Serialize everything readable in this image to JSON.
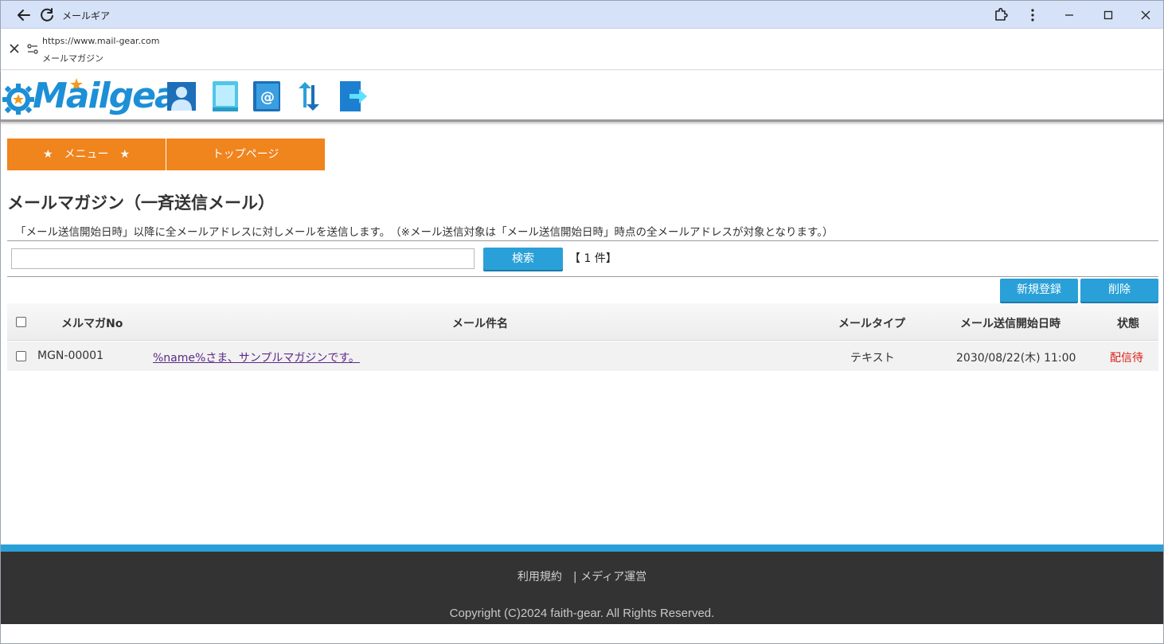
{
  "browser": {
    "tab_title": "メールギア",
    "url": "https://www.mail-gear.com",
    "page_title": "メールマガジン"
  },
  "header": {
    "logo_text": "Mailgear",
    "nav_icons": [
      "user-icon",
      "book-icon",
      "address-book-icon",
      "sync-icon",
      "logout-icon"
    ]
  },
  "tabs": [
    {
      "label": "★　メニュー　★"
    },
    {
      "label": "トップページ"
    }
  ],
  "main": {
    "title": "メールマガジン（一斉送信メール）",
    "description": "「メール送信開始日時」以降に全メールアドレスに対しメールを送信します。　（※メール送信対象は「メール送信開始日時」時点の全メールアドレスが対象となります。）",
    "search_value": "",
    "search_button": "検索",
    "count_label": "【 1 件】",
    "new_button": "新規登録",
    "delete_button": "削除"
  },
  "table": {
    "headers": {
      "no": "メルマガNo",
      "subject": "メール件名",
      "type": "メールタイプ",
      "start": "メール送信開始日時",
      "status": "状態"
    },
    "rows": [
      {
        "no": "MGN-00001",
        "subject": "%name%さま、サンプルマガジンです。",
        "type": "テキスト",
        "start": "2030/08/22(木) 11:00",
        "status": "配信待"
      }
    ]
  },
  "footer": {
    "links": "利用規約　| メディア運営",
    "copyright": "Copyright (C)2024 faith-gear. All Rights Reserved."
  },
  "colors": {
    "accent_orange": "#f0841d",
    "accent_blue": "#2aa0d8",
    "status_red": "#d8201a"
  }
}
